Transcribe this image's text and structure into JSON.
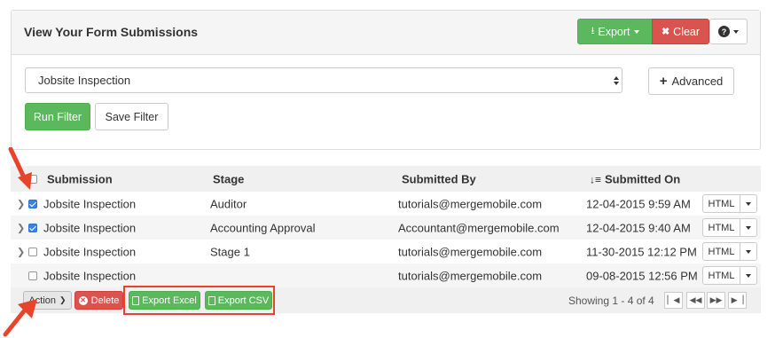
{
  "panel": {
    "title": "View Your Form Submissions",
    "export_label": "Export",
    "clear_label": "Clear",
    "help_icon": "?",
    "form_select": "Jobsite Inspection",
    "advanced_label": "Advanced",
    "run_filter_label": "Run Filter",
    "save_filter_label": "Save Filter"
  },
  "table": {
    "headers": {
      "submission": "Submission",
      "stage": "Stage",
      "submitted_by": "Submitted By",
      "submitted_on": "Submitted On"
    },
    "rows": [
      {
        "submission": "Jobsite Inspection",
        "stage": "Auditor",
        "submitted_by": "tutorials@mergemobile.com",
        "submitted_on": "12-04-2015 9:59 AM",
        "checked": true,
        "expandable": true
      },
      {
        "submission": "Jobsite Inspection",
        "stage": "Accounting Approval",
        "submitted_by": "Accountant@mergemobile.com",
        "submitted_on": "12-04-2015 9:40 AM",
        "checked": true,
        "expandable": true
      },
      {
        "submission": "Jobsite Inspection",
        "stage": "Stage 1",
        "submitted_by": "tutorials@mergemobile.com",
        "submitted_on": "11-30-2015 12:12 PM",
        "checked": false,
        "expandable": true
      },
      {
        "submission": "Jobsite Inspection",
        "stage": "",
        "submitted_by": "tutorials@mergemobile.com",
        "submitted_on": "09-08-2015 12:56 PM",
        "checked": false,
        "expandable": false
      }
    ],
    "html_label": "HTML"
  },
  "footer": {
    "action_label": "Action",
    "delete_label": "Delete",
    "export_excel_label": "Export Excel",
    "export_csv_label": "Export CSV",
    "showing_text": "Showing 1 - 4 of 4"
  },
  "colors": {
    "success": "#5cb85c",
    "danger": "#d9534f",
    "checkbox": "#3b82e8",
    "annotation": "#e8442c"
  },
  "icons": [
    "download-icon",
    "x-icon",
    "question-icon",
    "plus-icon",
    "sort-icon",
    "chevron-right-icon",
    "excel-file-icon",
    "csv-file-icon",
    "first-page-icon",
    "prev-page-icon",
    "next-page-icon",
    "last-page-icon",
    "annotation-arrow-icon"
  ]
}
